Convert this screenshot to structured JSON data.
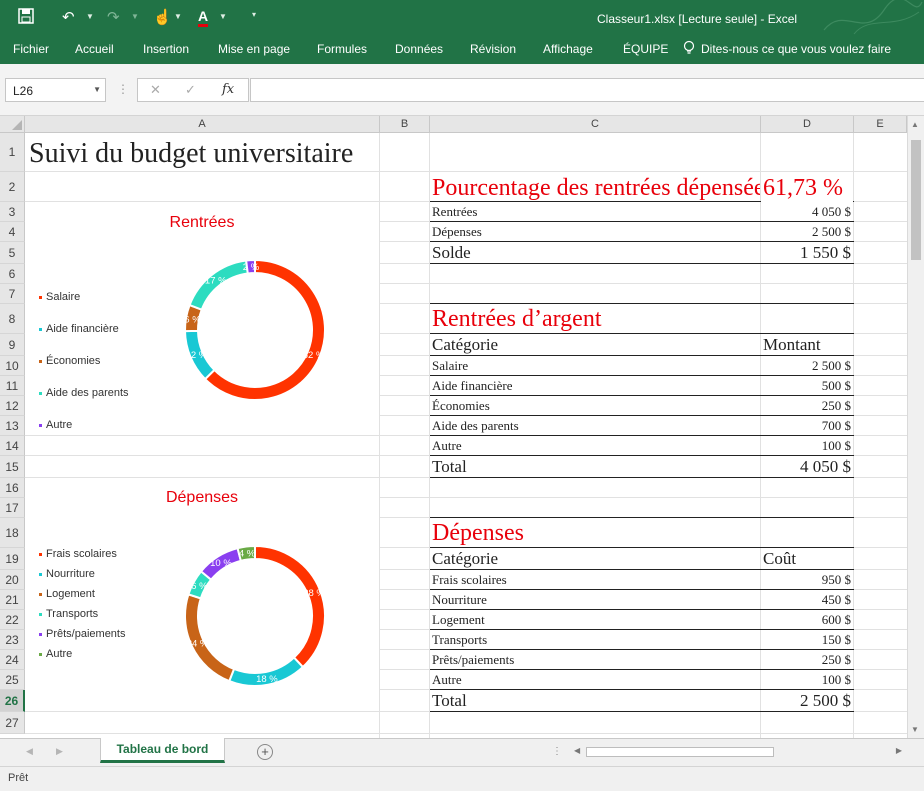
{
  "window": {
    "title": "Classeur1.xlsx  [Lecture seule]  -  Excel",
    "colors": {
      "ribbon": "#217346",
      "accent_red": "#e8000b"
    },
    "quick_access": [
      "save-icon",
      "undo-icon",
      "redo-icon",
      "touch-mode-icon",
      "font-color-icon",
      "customize-qat-icon"
    ]
  },
  "ribbon": {
    "tabs": [
      "Fichier",
      "Accueil",
      "Insertion",
      "Mise en page",
      "Formules",
      "Données",
      "Révision",
      "Affichage",
      "ÉQUIPE"
    ],
    "tell_me": "Dites-nous ce que vous voulez faire"
  },
  "formula_bar": {
    "name_box": "L26",
    "fx_label": "fx",
    "value": ""
  },
  "columns": [
    "A",
    "B",
    "C",
    "D",
    "E"
  ],
  "rows": [
    "1",
    "2",
    "3",
    "4",
    "5",
    "6",
    "7",
    "8",
    "9",
    "10",
    "11",
    "12",
    "13",
    "14",
    "15",
    "16",
    "17",
    "18",
    "19",
    "20",
    "21",
    "22",
    "23",
    "24",
    "25",
    "26",
    "27"
  ],
  "selected_row": "26",
  "sheet": {
    "title": "Suivi du budget universitaire",
    "pct_label": "Pourcentage des rentrées dépensées",
    "pct_value": "61,73 %",
    "summary": [
      {
        "label": "Rentrées",
        "value": "4 050 $"
      },
      {
        "label": "Dépenses",
        "value": "2 500 $"
      }
    ],
    "solde": {
      "label": "Solde",
      "value": "1 550 $"
    },
    "income": {
      "heading": "Rentrées d’argent",
      "col_cat": "Catégorie",
      "col_amt": "Montant",
      "items": [
        {
          "label": "Salaire",
          "value": "2 500 $"
        },
        {
          "label": "Aide financière",
          "value": "500 $"
        },
        {
          "label": "Économies",
          "value": "250 $"
        },
        {
          "label": "Aide des parents",
          "value": "700 $"
        },
        {
          "label": "Autre",
          "value": "100 $"
        }
      ],
      "total_label": "Total",
      "total_value": "4 050 $"
    },
    "expenses": {
      "heading": "Dépenses",
      "col_cat": "Catégorie",
      "col_amt": "Coût",
      "items": [
        {
          "label": "Frais scolaires",
          "value": "950 $"
        },
        {
          "label": "Nourriture",
          "value": "450 $"
        },
        {
          "label": "Logement",
          "value": "600 $"
        },
        {
          "label": "Transports",
          "value": "150 $"
        },
        {
          "label": "Prêts/paiements",
          "value": "250 $"
        },
        {
          "label": "Autre",
          "value": "100 $"
        }
      ],
      "total_label": "Total",
      "total_value": "2 500 $"
    }
  },
  "chart_data": [
    {
      "type": "pie",
      "title": "Rentrées",
      "legend": "left",
      "categories": [
        "Salaire",
        "Aide financière",
        "Économies",
        "Aide des parents",
        "Autre"
      ],
      "values": [
        62,
        12,
        6,
        17,
        2
      ],
      "labels": [
        "62 %",
        "12 %",
        "6 %",
        "17 %",
        "2 %"
      ],
      "colors": [
        "#ff3300",
        "#19c8d4",
        "#c86418",
        "#2ddcc0",
        "#8a3ff0"
      ]
    },
    {
      "type": "pie",
      "title": "Dépenses",
      "legend": "left",
      "categories": [
        "Frais scolaires",
        "Nourriture",
        "Logement",
        "Transports",
        "Prêts/paiements",
        "Autre"
      ],
      "values": [
        38,
        18,
        24,
        6,
        10,
        4
      ],
      "labels": [
        "38 %",
        "18 %",
        "24 %",
        "6 %",
        "10 %",
        "4 %"
      ],
      "colors": [
        "#ff3300",
        "#19c8d4",
        "#c86418",
        "#2ddcc0",
        "#8a3ff0",
        "#6aaa46"
      ]
    }
  ],
  "sheet_tabs": {
    "active": "Tableau de bord"
  },
  "status": {
    "text": "Prêt"
  }
}
